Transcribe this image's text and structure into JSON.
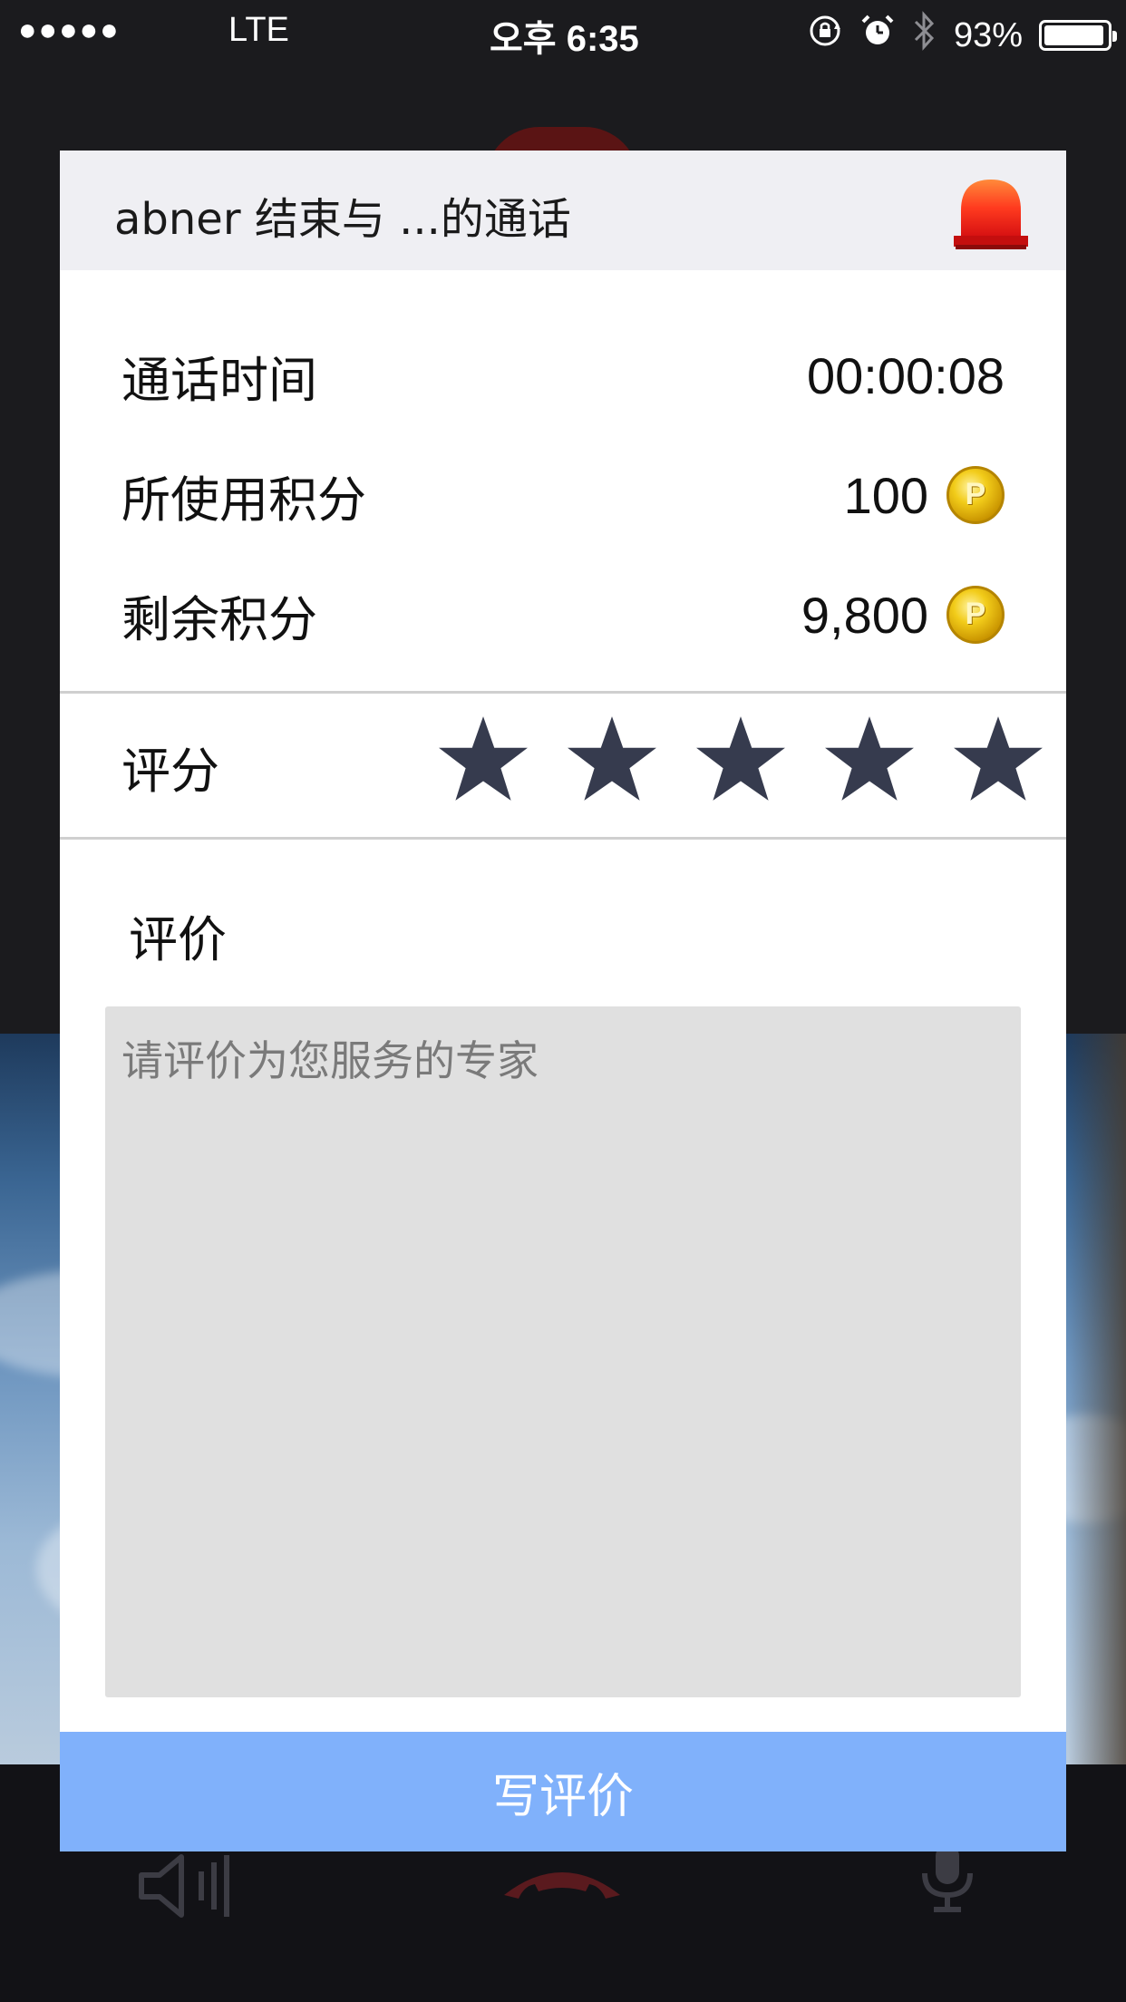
{
  "status_bar": {
    "signal": "●●●●●",
    "carrier": "LTE",
    "time": "오후 6:35",
    "battery_percent": "93%",
    "battery_level": 0.93
  },
  "dialog": {
    "title": "abner 结束与 ...的通话",
    "alarm_icon": "red-siren-icon",
    "rows": [
      {
        "label": "通话时间",
        "value": "00:00:08",
        "coin": false
      },
      {
        "label": "所使用积分",
        "value": "100",
        "coin": true
      },
      {
        "label": "剩余积分",
        "value": "9,800",
        "coin": true
      }
    ],
    "coin_letter": "P",
    "rating": {
      "label": "评分",
      "stars": 5,
      "selected": 5,
      "star_color": "#363b4e"
    },
    "review": {
      "label": "评价",
      "placeholder": "请评价为您服务的专家",
      "value": ""
    },
    "submit_label": "写评价",
    "submit_color": "#80b1fb"
  },
  "call_controls": {
    "speaker_icon": "speaker-icon",
    "hangup_icon": "hangup-phone-icon",
    "mic_icon": "microphone-icon"
  }
}
